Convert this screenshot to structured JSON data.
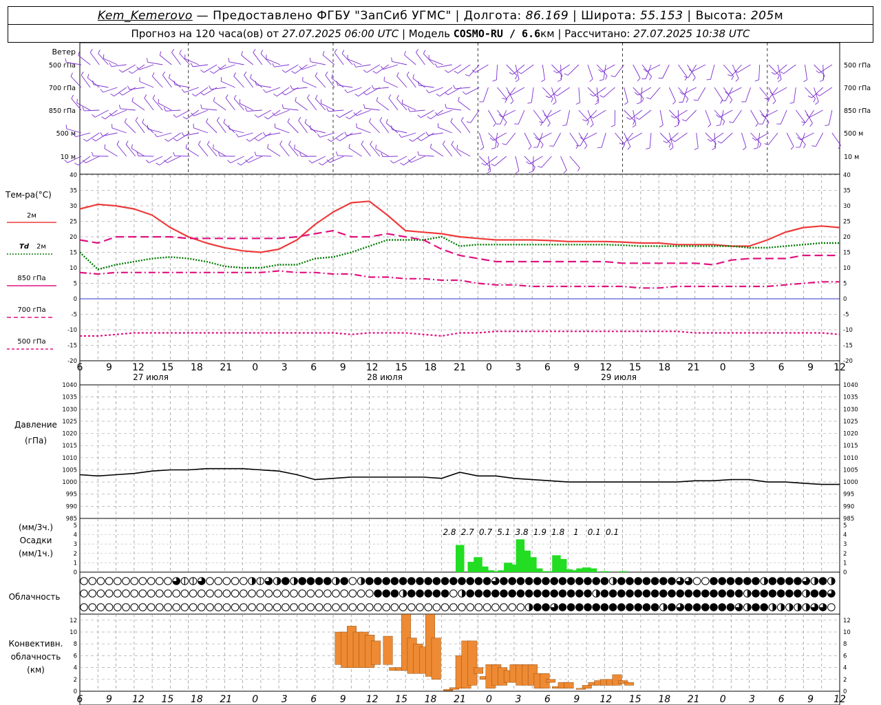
{
  "header": {
    "station": "Kem_Kemerovo",
    "provider": " — Предоставлено ФГБУ \"ЗапСиб УГМС\" | Долгота: ",
    "lon": "86.169",
    "lat_label": " | Широта: ",
    "lat": "55.153",
    "alt_label": " | Высота: ",
    "alt": "205",
    "alt_unit": "м",
    "forecast": "Прогноз на 120 часа(ов) от ",
    "start": "27.07.2025 06:00 UTC",
    "model_label": " | Модель ",
    "model": "COSMO-RU / 6.6",
    "model_unit": "км",
    "calc_label": " | Рассчитано: ",
    "calc": "27.07.2025 10:38 UTC"
  },
  "labels": {
    "wind": "Ветер",
    "wind_levels": [
      "500 гПа",
      "700 гПа",
      "850 гПа",
      "500 м",
      "10 м"
    ],
    "temp": "Тем-ра(°C)",
    "t2m": "2м",
    "td": "Td",
    "td2m": "2м",
    "l850": "850 гПа",
    "l700": "700 гПа",
    "l500": "500 гПа",
    "pressure": "Давление",
    "pressure_unit": "(гПа)",
    "precip_unit3": "(мм/3ч.)",
    "precip": "Осадки",
    "precip_unit1": "(мм/1ч.)",
    "clouds": "Облачность",
    "conv1": "Конвективн.",
    "conv2": "облачность",
    "conv_unit": "(км)"
  },
  "colors": {
    "t2m": "#ee3a3a",
    "td": "#007a00",
    "level": "#e0117f",
    "wind": "#7b2ccf",
    "precip": "#22dd22",
    "conv": "#ee8a33",
    "zero": "#3333cc"
  },
  "chart_data": [
    {
      "type": "line",
      "title": "Тем-ра(°C)",
      "x_hours": [
        0,
        3,
        6,
        9,
        12,
        15,
        18,
        21,
        24,
        27,
        30,
        33,
        36,
        39,
        42,
        45,
        48,
        51,
        54,
        57,
        60,
        63,
        66,
        69,
        72,
        75,
        78,
        81,
        84,
        87,
        90,
        93,
        96,
        99,
        102,
        105,
        108,
        111,
        114,
        117,
        120,
        123,
        126
      ],
      "ylim": [
        -20,
        40
      ],
      "series": [
        {
          "name": "2м",
          "values": [
            29,
            30.5,
            30,
            29,
            27,
            23,
            20,
            18,
            16.5,
            15.5,
            15,
            16,
            19,
            24,
            28,
            31,
            31.5,
            27,
            22,
            21.5,
            21,
            20,
            19.5,
            19,
            19,
            19,
            18.8,
            18.5,
            18.5,
            18.5,
            18.3,
            18,
            18,
            17.5,
            17.5,
            17.5,
            17,
            17,
            19,
            21.5,
            23,
            23.5,
            23
          ]
        },
        {
          "name": "Td 2м",
          "values": [
            15,
            9.5,
            11,
            12,
            13,
            13.5,
            13,
            12,
            10.5,
            10,
            10,
            11,
            11,
            13,
            13.5,
            15,
            17,
            19,
            19,
            19,
            20,
            17,
            17.5,
            17.5,
            17.5,
            17.5,
            17.5,
            17.5,
            17.5,
            17.5,
            17.3,
            17,
            17,
            17,
            17,
            17,
            17,
            16.5,
            16.5,
            17,
            17.5,
            18,
            18
          ]
        },
        {
          "name": "850 гПа",
          "values": [
            19,
            18,
            20,
            20,
            20,
            20,
            19.5,
            19.5,
            19.5,
            19.5,
            19.5,
            19.5,
            20,
            21,
            22,
            20,
            20,
            21,
            20,
            19,
            16,
            14,
            13,
            12,
            12,
            12,
            12,
            12,
            12,
            12,
            11.5,
            11.5,
            11.5,
            11.5,
            11.5,
            11,
            12.5,
            13,
            13,
            13,
            14,
            14,
            14
          ]
        },
        {
          "name": "700 гПа",
          "values": [
            8.5,
            8,
            8.5,
            8.5,
            8.5,
            8.5,
            8.5,
            8.5,
            8.5,
            8.5,
            8.5,
            9,
            8.5,
            8.5,
            8,
            8,
            7,
            7,
            6.5,
            6.5,
            6,
            6,
            5,
            4.5,
            4.5,
            4,
            4,
            4,
            4,
            4,
            4,
            3.5,
            3.5,
            4,
            4,
            4,
            4,
            4,
            4,
            4.5,
            5,
            5.5,
            5.5
          ]
        },
        {
          "name": "500 гПа",
          "values": [
            -12,
            -12,
            -11.5,
            -11,
            -11,
            -11,
            -11,
            -11,
            -11,
            -11,
            -11,
            -11,
            -11,
            -11,
            -11,
            -11.5,
            -11,
            -11,
            -11,
            -11.5,
            -12,
            -11,
            -11,
            -10.5,
            -10.5,
            -10.5,
            -10.5,
            -10.5,
            -10.5,
            -10.5,
            -10.5,
            -10.5,
            -10.5,
            -10.5,
            -11,
            -11,
            -11,
            -11,
            -11,
            -11,
            -11,
            -11,
            -11.5
          ]
        }
      ],
      "ticks_x": [
        "6",
        "9",
        "12",
        "15",
        "18",
        "21",
        "0",
        "3",
        "6",
        "9",
        "12",
        "15",
        "18",
        "21",
        "0",
        "3",
        "6",
        "9",
        "12",
        "15",
        "18",
        "21",
        "0",
        "3",
        "6",
        "9",
        "12"
      ],
      "dates": [
        "27 июля",
        "28 июля",
        "29 июля"
      ]
    },
    {
      "type": "line",
      "title": "Давление",
      "ylabel": "(гПа)",
      "ylim": [
        985,
        1040
      ],
      "x_hours": [
        0,
        3,
        6,
        9,
        12,
        15,
        18,
        21,
        24,
        27,
        30,
        33,
        36,
        39,
        42,
        45,
        48,
        51,
        54,
        57,
        60,
        63,
        66,
        69,
        72,
        75,
        78,
        81,
        84,
        87,
        90,
        93,
        96,
        99,
        102,
        105,
        108,
        111,
        114,
        117,
        120,
        123,
        126
      ],
      "series": [
        {
          "name": "Давление",
          "values": [
            1003,
            1002.5,
            1003,
            1003.5,
            1004.5,
            1005,
            1005,
            1005.5,
            1005.5,
            1005.5,
            1005,
            1004.5,
            1003,
            1001,
            1001.5,
            1002,
            1002,
            1002,
            1002,
            1002,
            1001.5,
            1004,
            1002.5,
            1002.5,
            1001.5,
            1001,
            1000.5,
            1000,
            1000,
            1000,
            1000,
            1000,
            1000,
            1000,
            1000.5,
            1000.5,
            1001,
            1001,
            1000,
            1000,
            999.5,
            999,
            999
          ]
        }
      ]
    },
    {
      "type": "bar",
      "title": "Осадки",
      "ylim": [
        0,
        5
      ],
      "labels_3h": [
        "2.8",
        "2.7",
        "0.7",
        "5.1",
        "3.8",
        "1.9",
        "1.8",
        "1",
        "0.1",
        "0.1"
      ],
      "label_hours": [
        63,
        66,
        69,
        72,
        75,
        78,
        81,
        84,
        87,
        90
      ],
      "x_hours": [
        63,
        64,
        65,
        66,
        67,
        68,
        69,
        70,
        71,
        72,
        73,
        74,
        75,
        76,
        77,
        78,
        79,
        80,
        81,
        82,
        83,
        84,
        85,
        86,
        87,
        88,
        89,
        90
      ],
      "values": [
        2.9,
        0,
        1.1,
        1.6,
        0.6,
        0.2,
        0.1,
        0.2,
        1.0,
        0.8,
        3.5,
        2.3,
        1.6,
        0.4,
        0.1,
        0.1,
        1.8,
        1.4,
        0.3,
        0.2,
        0.4,
        0.5,
        0.4,
        0,
        0.1,
        0,
        0,
        0.1
      ]
    },
    {
      "type": "table",
      "title": "Облачность",
      "rows": [
        "000000000003113000002132424444240244444444444444434444444444444244444443300444444244443242",
        "000000000000000000000000000000000004442444440244444444444444424444444444444444424444442443",
        "000000000000000000000000000000000000000000000000000002443444444444444243444444324422222330"
      ]
    },
    {
      "type": "bar",
      "title": "Конвективн. облачность",
      "ylabel": "(км)",
      "ylim": [
        0,
        13
      ],
      "bars": [
        {
          "h": 43,
          "base": 4.5,
          "top": 10
        },
        {
          "h": 44,
          "base": 4,
          "top": 10
        },
        {
          "h": 45,
          "base": 4,
          "top": 11
        },
        {
          "h": 46,
          "base": 4,
          "top": 10
        },
        {
          "h": 47,
          "base": 4,
          "top": 10
        },
        {
          "h": 48,
          "base": 4,
          "top": 9.5
        },
        {
          "h": 49,
          "base": 4.5,
          "top": 8.5
        },
        {
          "h": 51,
          "base": 4.5,
          "top": 9.3
        },
        {
          "h": 52,
          "base": 3.5,
          "top": 4
        },
        {
          "h": 53,
          "base": 3.5,
          "top": 4
        },
        {
          "h": 54,
          "base": 3.5,
          "top": 13
        },
        {
          "h": 55,
          "base": 3,
          "top": 9
        },
        {
          "h": 56,
          "base": 3,
          "top": 8
        },
        {
          "h": 57,
          "base": 3,
          "top": 7.5
        },
        {
          "h": 58,
          "base": 2.5,
          "top": 13
        },
        {
          "h": 59,
          "base": 2,
          "top": 9
        },
        {
          "h": 61,
          "base": 0.1,
          "top": 0.3
        },
        {
          "h": 62,
          "base": 0.3,
          "top": 0.6
        },
        {
          "h": 63,
          "base": 0.5,
          "top": 6
        },
        {
          "h": 64,
          "base": 0.5,
          "top": 8.5
        },
        {
          "h": 65,
          "base": 1,
          "top": 8.5
        },
        {
          "h": 66,
          "base": 3,
          "top": 4
        },
        {
          "h": 67,
          "base": 2,
          "top": 2.5
        },
        {
          "h": 68,
          "base": 0.5,
          "top": 4.5
        },
        {
          "h": 69,
          "base": 1,
          "top": 4.5
        },
        {
          "h": 70,
          "base": 1,
          "top": 4
        },
        {
          "h": 71,
          "base": 1.5,
          "top": 3.5
        },
        {
          "h": 72,
          "base": 1.5,
          "top": 4.5
        },
        {
          "h": 73,
          "base": 1,
          "top": 4.5
        },
        {
          "h": 74,
          "base": 1,
          "top": 4.5
        },
        {
          "h": 75,
          "base": 1,
          "top": 4.5
        },
        {
          "h": 76,
          "base": 0.5,
          "top": 3
        },
        {
          "h": 77,
          "base": 0.5,
          "top": 3
        },
        {
          "h": 78,
          "base": 1.5,
          "top": 2
        },
        {
          "h": 79,
          "base": 0.5,
          "top": 0.8
        },
        {
          "h": 80,
          "base": 0.5,
          "top": 1.5
        },
        {
          "h": 81,
          "base": 0.5,
          "top": 1.5
        },
        {
          "h": 83,
          "base": 0.3,
          "top": 0.5
        },
        {
          "h": 84,
          "base": 0.5,
          "top": 1
        },
        {
          "h": 85,
          "base": 1,
          "top": 1.5
        },
        {
          "h": 86,
          "base": 1,
          "top": 1.8
        },
        {
          "h": 87,
          "base": 1,
          "top": 2
        },
        {
          "h": 88,
          "base": 1,
          "top": 2
        },
        {
          "h": 89,
          "base": 1,
          "top": 2.8
        },
        {
          "h": 90,
          "base": 1.3,
          "top": 1.8
        },
        {
          "h": 91,
          "base": 1,
          "top": 1.5
        }
      ]
    }
  ]
}
